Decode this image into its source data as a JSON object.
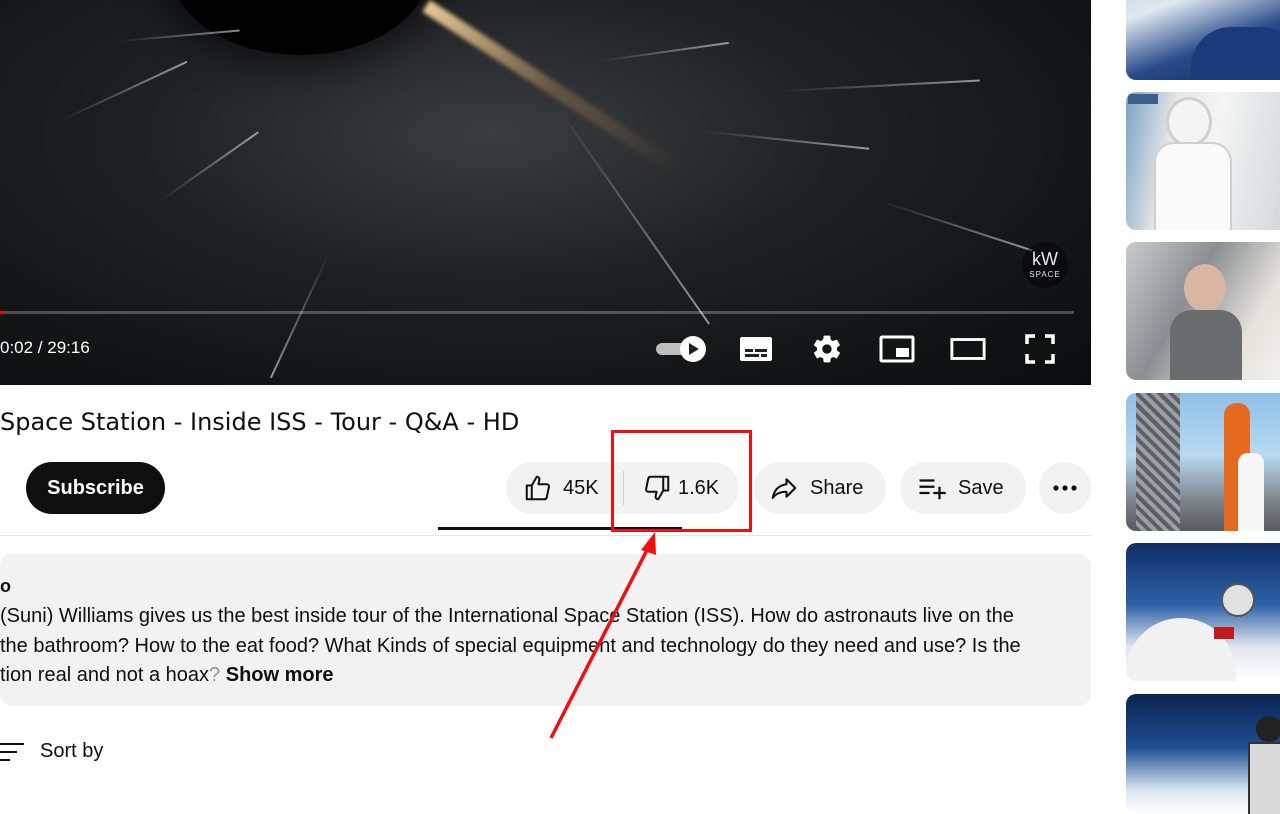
{
  "player": {
    "time_display": "0:02 / 29:16",
    "progress_fraction": 0.001,
    "watermark_main": "kW",
    "watermark_sub": "SPACE",
    "autoplay_on": true
  },
  "video": {
    "title": "Space Station - Inside ISS - Tour - Q&A - HD"
  },
  "actions": {
    "subscribe_label": "Subscribe",
    "like_count": "45K",
    "dislike_count": "1.6K",
    "share_label": "Share",
    "save_label": "Save"
  },
  "description": {
    "meta_partial": "o",
    "line1": "(Suni) Williams gives us the best inside tour of the International Space Station (ISS). How do astronauts live on the",
    "line2": "the bathroom? How to the eat food? What Kinds of special equipment and technology do they need and use? Is the",
    "line3_text": "tion real and not a hoax",
    "line3_fade": "?",
    "show_more": "Show more"
  },
  "comments": {
    "sort_label": "Sort by"
  },
  "colors": {
    "highlight": "#f01010",
    "progress": "#ff0000"
  }
}
